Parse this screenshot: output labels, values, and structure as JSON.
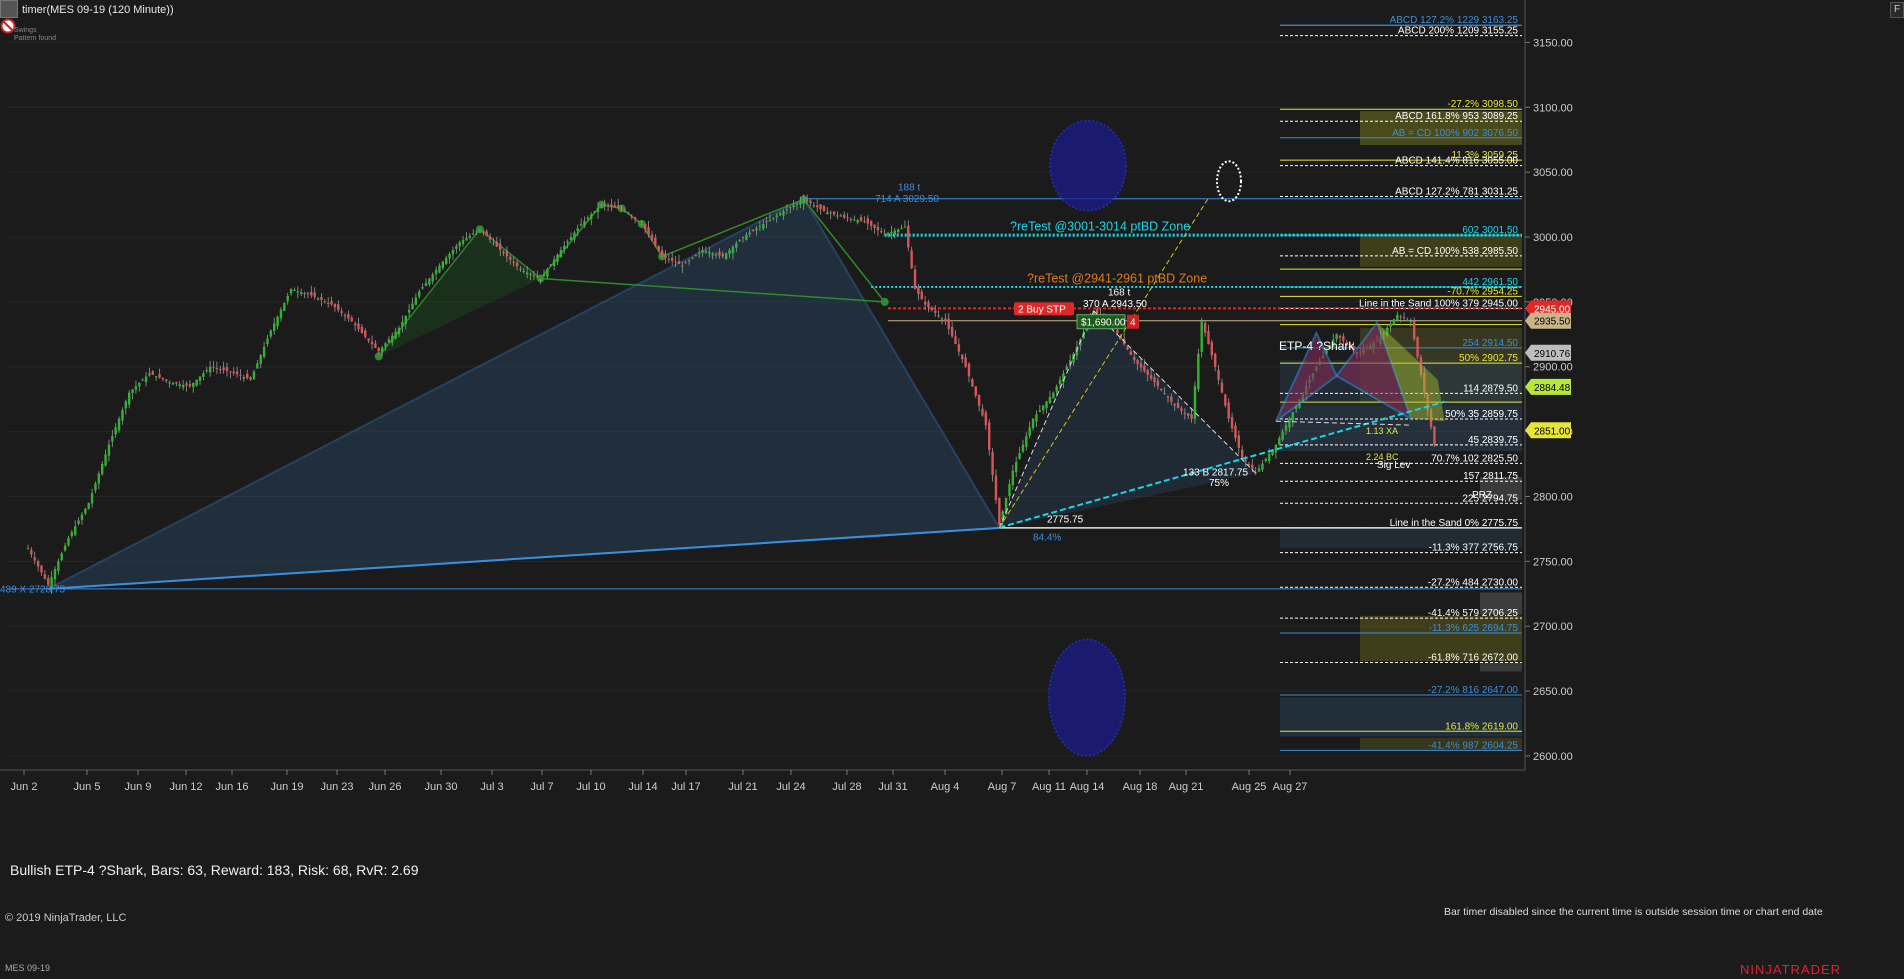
{
  "header": {
    "title": "timer(MES 09-19 (120 Minute))",
    "sub1": "Swings",
    "sub2": "Pattern found",
    "f_button": "F"
  },
  "footer": {
    "copyright": "© 2019 NinjaTrader, LLC",
    "symbol": "MES 09-19",
    "logo": "NINJATRADER",
    "timer_msg": "Bar timer disabled since the current time is outside session time or chart end date"
  },
  "stats_text": "Bullish ETP-4 ?Shark, Bars: 63, Reward: 183, Risk: 68, RvR: 2.69",
  "colors": {
    "bg": "#1b1b1b",
    "up": "#2fb52f",
    "down": "#d8555a",
    "blue": "#3a8ee0",
    "green": "#2e8b2e",
    "cyan": "#19d6e6",
    "orange": "#e07a1a",
    "yellow": "#e6e63a",
    "red_marker": "#e02828"
  },
  "chart_data": {
    "type": "candlestick",
    "title": "timer(MES 09-19 (120 Minute))",
    "ylim": [
      2593,
      3175
    ],
    "y_ticks": [
      2600,
      2650,
      2700,
      2750,
      2800,
      2850,
      2900,
      2950,
      3000,
      3050,
      3100,
      3150
    ],
    "x_ticks": [
      "Jun 2",
      "Jun 5",
      "Jun 9",
      "Jun 12",
      "Jun 16",
      "Jun 19",
      "Jun 23",
      "Jun 26",
      "Jun 30",
      "Jul 3",
      "Jul 7",
      "Jul 10",
      "Jul 14",
      "Jul 17",
      "Jul 21",
      "Jul 24",
      "Jul 28",
      "Jul 31",
      "Aug 4",
      "Aug 7",
      "Aug 11",
      "Aug 14",
      "Aug 18",
      "Aug 21",
      "Aug 25",
      "Aug 27"
    ],
    "price_path": [
      [
        0,
        2760
      ],
      [
        6,
        2732
      ],
      [
        12,
        2768
      ],
      [
        18,
        2795
      ],
      [
        24,
        2840
      ],
      [
        30,
        2880
      ],
      [
        36,
        2895
      ],
      [
        42,
        2888
      ],
      [
        48,
        2885
      ],
      [
        54,
        2900
      ],
      [
        60,
        2896
      ],
      [
        66,
        2890
      ],
      [
        72,
        2928
      ],
      [
        78,
        2960
      ],
      [
        84,
        2955
      ],
      [
        90,
        2948
      ],
      [
        96,
        2935
      ],
      [
        101,
        2920
      ],
      [
        104,
        2912
      ],
      [
        110,
        2930
      ],
      [
        116,
        2958
      ],
      [
        122,
        2978
      ],
      [
        128,
        2996
      ],
      [
        134,
        3006
      ],
      [
        140,
        2990
      ],
      [
        146,
        2975
      ],
      [
        152,
        2968
      ],
      [
        158,
        2990
      ],
      [
        164,
        3010
      ],
      [
        170,
        3025
      ],
      [
        176,
        3022
      ],
      [
        182,
        3010
      ],
      [
        188,
        2985
      ],
      [
        194,
        2978
      ],
      [
        200,
        2990
      ],
      [
        206,
        2985
      ],
      [
        212,
        3000
      ],
      [
        218,
        3010
      ],
      [
        224,
        3020
      ],
      [
        230,
        3029
      ],
      [
        236,
        3020
      ],
      [
        242,
        3015
      ],
      [
        248,
        3012
      ],
      [
        254,
        3002
      ],
      [
        260,
        3008
      ],
      [
        263,
        2960
      ],
      [
        266,
        2948
      ],
      [
        272,
        2935
      ],
      [
        278,
        2900
      ],
      [
        284,
        2855
      ],
      [
        288,
        2778
      ],
      [
        292,
        2820
      ],
      [
        298,
        2860
      ],
      [
        304,
        2880
      ],
      [
        310,
        2910
      ],
      [
        316,
        2943
      ],
      [
        322,
        2930
      ],
      [
        328,
        2905
      ],
      [
        334,
        2888
      ],
      [
        340,
        2870
      ],
      [
        345,
        2860
      ],
      [
        348,
        2935
      ],
      [
        352,
        2900
      ],
      [
        356,
        2860
      ],
      [
        360,
        2830
      ],
      [
        364,
        2818
      ],
      [
        370,
        2840
      ],
      [
        376,
        2870
      ],
      [
        382,
        2900
      ],
      [
        388,
        2925
      ],
      [
        394,
        2910
      ],
      [
        400,
        2920
      ],
      [
        406,
        2940
      ],
      [
        410,
        2935
      ],
      [
        414,
        2880
      ],
      [
        417,
        2840
      ]
    ],
    "price_labels": [
      {
        "price": 3163.25,
        "text": "ABCD  127.2%  1229",
        "color": "#3a8ee0"
      },
      {
        "price": 3155.25,
        "text": "ABCD  200%  1209",
        "color": "#ffffff"
      },
      {
        "price": 3098.5,
        "text": "-27.2%",
        "color": "#e6e63a"
      },
      {
        "price": 3089.25,
        "text": "ABCD  161.8%  953",
        "color": "#ffffff"
      },
      {
        "price": 3076.5,
        "text": "AB = CD  100%  902",
        "color": "#3a8ee0"
      },
      {
        "price": 3059.25,
        "text": "11.3%",
        "color": "#e6e63a"
      },
      {
        "price": 3055.0,
        "text": "ABCD  141.4%  816",
        "color": "#ffffff"
      },
      {
        "price": 3031.25,
        "text": "ABCD  127.2%  781",
        "color": "#ffffff"
      },
      {
        "price": 3001.5,
        "text": "602",
        "color": "#19d6e6"
      },
      {
        "price": 2985.5,
        "text": "AB = CD  100%  538",
        "color": "#ffffff"
      },
      {
        "price": 2975.25,
        "text": "",
        "color": "#e6e63a"
      },
      {
        "price": 2961.5,
        "text": "442",
        "color": "#19d6e6"
      },
      {
        "price": 2954.25,
        "text": "-70.7%",
        "color": "#e6e63a"
      },
      {
        "price": 2945.0,
        "text": "Line in the Sand  100%  379",
        "color": "#ffffff"
      },
      {
        "price": 2932.5,
        "text": "",
        "color": "#e6e63a"
      },
      {
        "price": 2914.5,
        "text": "254",
        "color": "#3a8ee0"
      },
      {
        "price": 2902.75,
        "text": "50%",
        "color": "#e6e63a"
      },
      {
        "price": 2879.5,
        "text": "114",
        "color": "#ffffff"
      },
      {
        "price": 2872.75,
        "text": "",
        "color": "#e6e63a"
      },
      {
        "price": 2859.75,
        "text": "50%  35",
        "color": "#ffffff"
      },
      {
        "price": 2839.75,
        "text": "45",
        "color": "#ffffff"
      },
      {
        "price": 2825.5,
        "text": "70.7%  102",
        "color": "#ffffff"
      },
      {
        "price": 2811.75,
        "text": "157",
        "color": "#ffffff"
      },
      {
        "price": 2794.75,
        "text": "225",
        "color": "#ffffff"
      },
      {
        "price": 2775.75,
        "text": "Line in the Sand  0%",
        "color": "#ffffff"
      },
      {
        "price": 2756.75,
        "text": "-11.3%  377",
        "color": "#ffffff"
      },
      {
        "price": 2730.0,
        "text": "-27.2%  484",
        "color": "#ffffff"
      },
      {
        "price": 2706.25,
        "text": "-41.4%  579",
        "color": "#ffffff"
      },
      {
        "price": 2694.75,
        "text": "-11.3%  625",
        "color": "#3a8ee0"
      },
      {
        "price": 2672.0,
        "text": "-61.8%  716",
        "color": "#ffffff"
      },
      {
        "price": 2647.0,
        "text": "-27.2%  816",
        "color": "#3a8ee0"
      },
      {
        "price": 2619.0,
        "text": "161.8%",
        "color": "#e6e63a"
      },
      {
        "price": 2604.25,
        "text": "-41.4%  987",
        "color": "#3a8ee0"
      }
    ],
    "axis_markers": [
      {
        "price": 2945.0,
        "text": "2945.00",
        "bg": "#e02828",
        "fg": "#ffffff"
      },
      {
        "price": 2935.5,
        "text": "2935.50",
        "bg": "#c9b48a",
        "fg": "#000000"
      },
      {
        "price": 2910.76,
        "text": "2910.76",
        "bg": "#bdbdbd",
        "fg": "#000000"
      },
      {
        "price": 2884.48,
        "text": "2884.48",
        "bg": "#b6e63a",
        "fg": "#000000"
      },
      {
        "price": 2851.0,
        "text": "2851.00",
        "bg": "#e6e63a",
        "fg": "#000000"
      }
    ],
    "annotations": [
      {
        "text": "?reTest @3001-3014 ptBD Zone",
        "color": "#19d6e6"
      },
      {
        "text": "?reTest @2941-2961 ptBD Zone",
        "color": "#e07a1a"
      },
      {
        "text": "188 t",
        "color": "#3a8ee0"
      },
      {
        "text": "714  A  3029.50",
        "color": "#3a8ee0"
      },
      {
        "text": "489  X  2728.75",
        "color": "#3a8ee0"
      },
      {
        "text": "84.4%",
        "color": "#3a8ee0"
      },
      {
        "text": "2775.75",
        "color": "#ffffff"
      },
      {
        "text": "133  B  2817.75",
        "color": "#ffffff"
      },
      {
        "text": "75%",
        "color": "#ffffff"
      },
      {
        "text": "370  A  2943.50",
        "color": "#ffffff"
      },
      {
        "text": "168 t",
        "color": "#ffffff"
      },
      {
        "text": "ETP-4 ?Shark",
        "color": "#ffffff"
      },
      {
        "text": "PRZ",
        "color": "#ffffff"
      },
      {
        "text": "Sig Lev",
        "color": "#ffffff"
      },
      {
        "text": "1.13 XA",
        "color": "#e6e63a"
      },
      {
        "text": "2.24 BC",
        "color": "#e6e63a"
      }
    ],
    "order": {
      "qty": "2",
      "label": "Buy STP",
      "pnl": "$1,690.00",
      "count": "4"
    }
  }
}
